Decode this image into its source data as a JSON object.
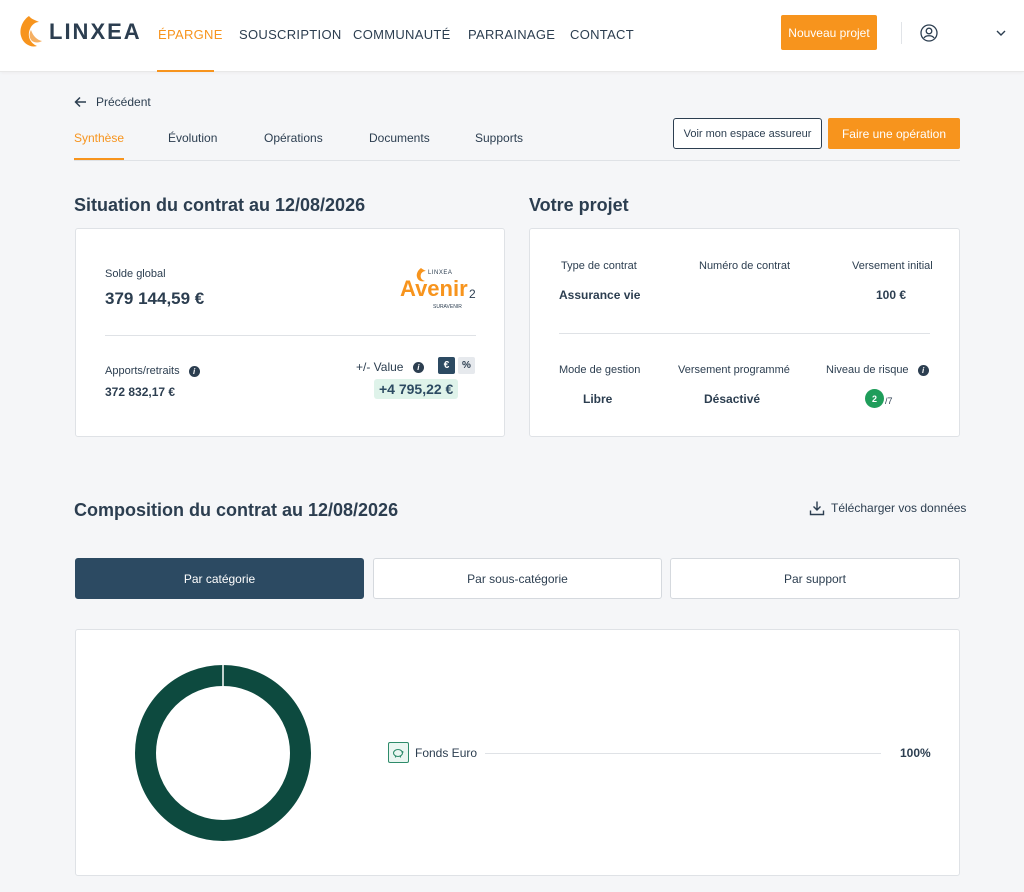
{
  "nav": {
    "brand": "LINXEA",
    "items": [
      "ÉPARGNE",
      "SOUSCRIPTION",
      "COMMUNAUTÉ",
      "PARRAINAGE",
      "CONTACT"
    ],
    "cta": "Nouveau projet"
  },
  "back_label": "Précédent",
  "tabs": [
    "Synthèse",
    "Évolution",
    "Opérations",
    "Documents",
    "Supports"
  ],
  "actions": {
    "espace": "Voir mon espace assureur",
    "operation": "Faire une opération"
  },
  "situation": {
    "title": "Situation du contrat au 12/08/2026",
    "solde_label": "Solde global",
    "solde_value": "379 144,59 €",
    "apports_label": "Apports/retraits",
    "apports_value": "372 832,17 €",
    "plusvalue_label": "+/- Value",
    "currency_toggle": "€",
    "percent_toggle": "%",
    "plusvalue_value": "+4 795,22 €",
    "logo": {
      "top": "LINXEA",
      "main": "Avenir",
      "suffix": "2",
      "sub": "SURAVENIR"
    }
  },
  "projet": {
    "title": "Votre projet",
    "type_label": "Type de contrat",
    "type_value": "Assurance vie",
    "numero_label": "Numéro de contrat",
    "versement_label": "Versement initial",
    "versement_value": "100 €",
    "gestion_label": "Mode de gestion",
    "gestion_value": "Libre",
    "programme_label": "Versement programmé",
    "programme_value": "Désactivé",
    "risque_label": "Niveau de risque",
    "risque_value": "2",
    "risque_max": "/7"
  },
  "composition": {
    "title": "Composition du contrat au 12/08/2026",
    "download": "Télécharger vos données",
    "segments": [
      "Par catégorie",
      "Par sous-catégorie",
      "Par support"
    ],
    "legend_label": "Fonds Euro",
    "legend_value": "100%"
  },
  "chart_data": {
    "type": "pie",
    "categories": [
      "Fonds Euro"
    ],
    "values": [
      100
    ],
    "colors": [
      "#0d4a3f"
    ]
  },
  "colors": {
    "accent": "#f7941d",
    "navy": "#2c3e50",
    "donut": "#0d4a3f",
    "gain_bg": "#dff3ea"
  }
}
